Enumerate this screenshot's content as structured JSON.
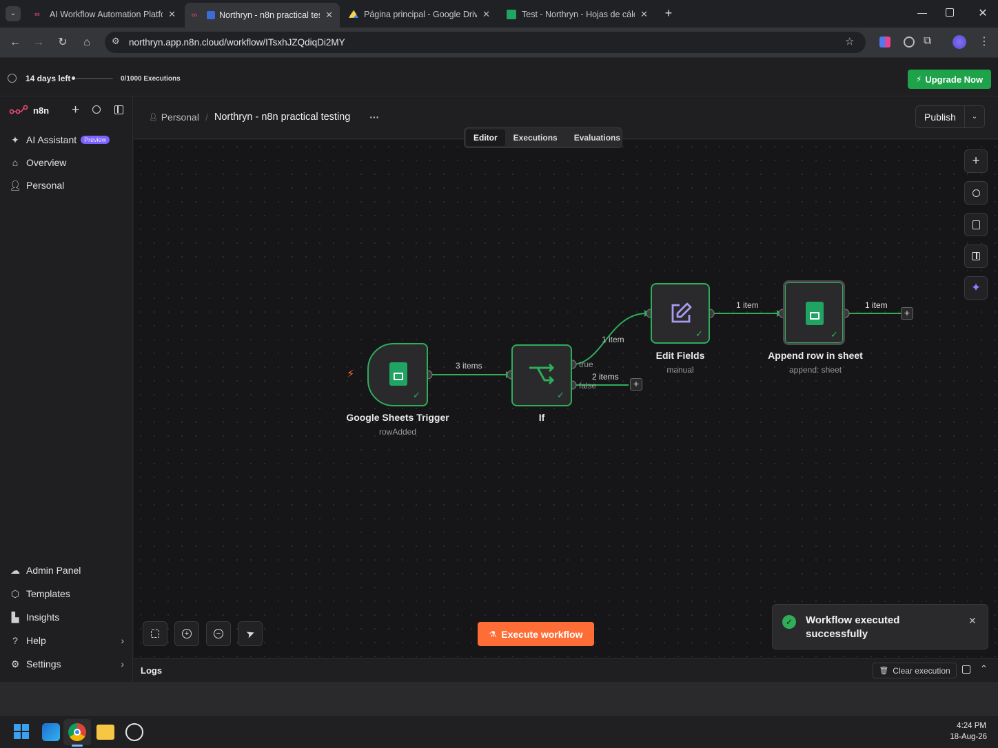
{
  "browser": {
    "tabs": [
      {
        "label": "AI Workflow Automation Platfo",
        "active": false
      },
      {
        "label": "Northryn - n8n practical tes",
        "active": true
      },
      {
        "label": "Página principal - Google Drive",
        "active": false
      },
      {
        "label": "Test - Northryn - Hojas de cálcu",
        "active": false
      }
    ],
    "url": "northryn.app.n8n.cloud/workflow/ITsxhJZQdiqDi2MY"
  },
  "trial": {
    "days_left": "14 days left",
    "executions": "0/1000 Executions",
    "upgrade_label": "Upgrade Now"
  },
  "sidebar": {
    "brand": "n8n",
    "items": [
      {
        "label": "AI Assistant",
        "badge": "Preview",
        "icon": "sparkle-icon"
      },
      {
        "label": "Overview",
        "icon": "home-icon"
      },
      {
        "label": "Personal",
        "icon": "user-icon"
      }
    ],
    "bottom_items": [
      {
        "label": "Admin Panel",
        "icon": "cloud-icon"
      },
      {
        "label": "Templates",
        "icon": "box-icon"
      },
      {
        "label": "Insights",
        "icon": "chart-icon"
      },
      {
        "label": "Help",
        "icon": "help-icon"
      },
      {
        "label": "Settings",
        "icon": "gear-icon"
      }
    ]
  },
  "header": {
    "breadcrumb_project": "Personal",
    "workflow_name": "Northryn - n8n practical testing",
    "more": "···",
    "publish_label": "Publish",
    "tabs": [
      "Editor",
      "Executions",
      "Evaluations"
    ],
    "active_tab": "Editor"
  },
  "workflow": {
    "nodes": [
      {
        "id": "trigger",
        "label": "Google Sheets Trigger",
        "sub": "rowAdded"
      },
      {
        "id": "if",
        "label": "If",
        "sub": ""
      },
      {
        "id": "edit",
        "label": "Edit Fields",
        "sub": "manual"
      },
      {
        "id": "append",
        "label": "Append row in sheet",
        "sub": "append: sheet"
      }
    ],
    "edges": {
      "trigger_to_if": "3 items",
      "if_true": "1 item",
      "if_false": "2 items",
      "edit_to_append": "1 item",
      "append_out": "1 item"
    },
    "branch_true": "true",
    "branch_false": "false"
  },
  "actions": {
    "execute_label": "Execute workflow"
  },
  "toast": {
    "message": "Workflow executed successfully"
  },
  "logs": {
    "title": "Logs",
    "clear_label": "Clear execution"
  },
  "taskbar": {
    "time": "4:24 PM",
    "date": "18-Aug-26"
  },
  "colors": {
    "accent_orange": "#ff6d36",
    "success_green": "#2fae5a",
    "upgrade_green": "#1ea24a",
    "preview_purple": "#7b61ff"
  }
}
